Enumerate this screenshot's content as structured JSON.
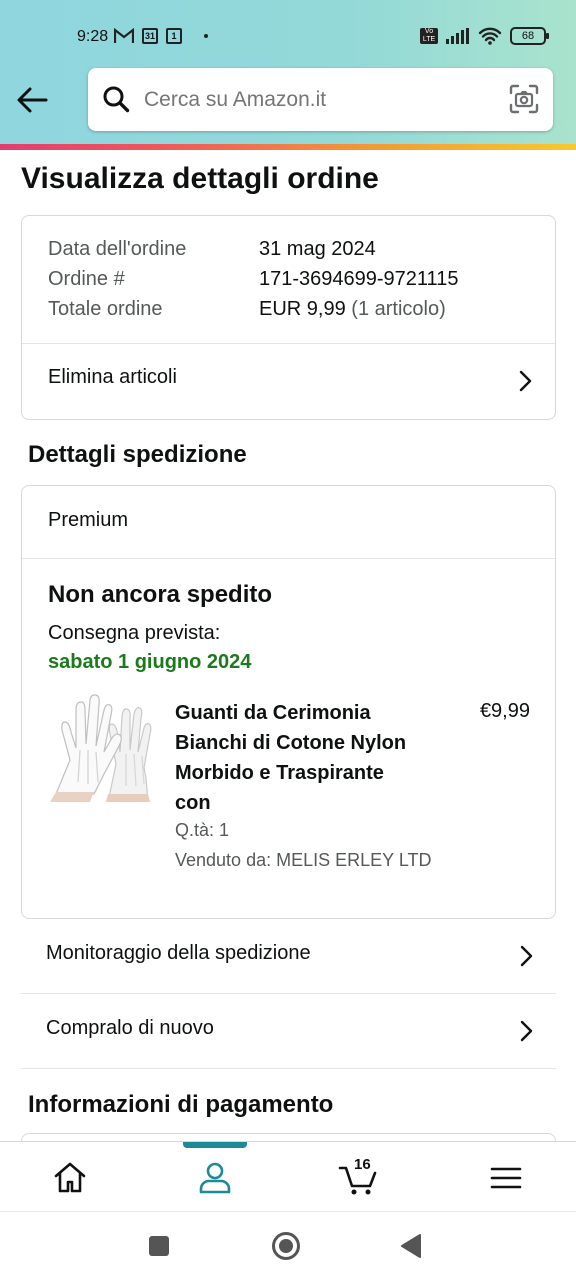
{
  "status_bar": {
    "time": "9:28",
    "calendar_day": "31",
    "notification_box": "1",
    "network_label": "Vo LTE",
    "battery": "68"
  },
  "search": {
    "placeholder": "Cerca su Amazon.it"
  },
  "page": {
    "title": "Visualizza dettagli ordine"
  },
  "order_summary": {
    "rows": [
      {
        "label": "Data dell'ordine",
        "value": "31 mag 2024"
      },
      {
        "label": "Ordine #",
        "value": "171-3694699-9721115"
      },
      {
        "label": "Totale ordine",
        "value": "EUR 9,99",
        "extra": "(1 articolo)"
      }
    ],
    "delete_items": "Elimina articoli"
  },
  "shipping": {
    "section_title": "Dettagli spedizione",
    "service": "Premium",
    "status": "Non ancora spedito",
    "delivery_label": "Consegna prevista:",
    "delivery_date": "sabato 1 giugno 2024",
    "product": {
      "name": "Guanti da Cerimonia Bianchi di Cotone Nylon Morbido e Traspirante con",
      "price": "€9,99",
      "quantity": "Q.tà: 1",
      "seller": "Venduto da: MELIS ERLEY LTD"
    },
    "track": "Monitoraggio della spedizione",
    "buy_again": "Compralo di nuovo"
  },
  "payment": {
    "section_title": "Informazioni di pagamento"
  },
  "bottom_nav": {
    "cart_count": "16",
    "active": "account",
    "accent_color": "#1d8a99"
  }
}
